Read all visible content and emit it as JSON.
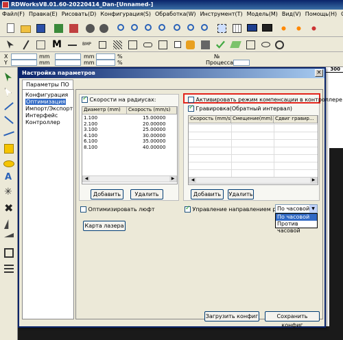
{
  "app": {
    "title": "RDWorksV8.01.60-20220414_Dan-[Unnamed-]"
  },
  "menu": [
    "Файл(F)",
    "Правка(E)",
    "Рисовать(D)",
    "Конфигурация(S)",
    "Обработка(W)",
    "Инструмент(T)",
    "Модель(M)",
    "Вид(V)",
    "Помощь(H)",
    "Связь со всеми"
  ],
  "coords": {
    "x_label": "X",
    "y_label": "Y",
    "x_value": "0",
    "y_value": "0",
    "unit1": "mm",
    "unit2": "mm",
    "pct": "%",
    "num_label": "№",
    "process_label": "Процесса:",
    "process_value": "0"
  },
  "ruler": {
    "tick": "300"
  },
  "dialog": {
    "title": "Настройка параметров",
    "close": "×",
    "tab": "Параметры ПО",
    "nav": [
      "Конфигурация",
      "Оптимизация",
      "Импорт/Экспорт",
      "Интерфейс",
      "Контроллер"
    ],
    "nav_selected": 1,
    "speeds_check": "Скорости на радиусах:",
    "speeds_cols": [
      "Диаметр (mm)",
      "Скорость (mm/s)"
    ],
    "speeds_rows": [
      [
        "1.100",
        "15.00000"
      ],
      [
        "2.100",
        "20.00000"
      ],
      [
        "3.100",
        "25.00000"
      ],
      [
        "4.100",
        "30.00000"
      ],
      [
        "6.100",
        "35.00000"
      ],
      [
        "8.100",
        "40.00000"
      ]
    ],
    "add": "Добавить",
    "delete": "Удалить",
    "compensation_check": "Активировать режим компенсации в контроллере",
    "engraving_check": "Гравировка(Обратный интервал)",
    "comp_cols": [
      "Скорость (mm/s)",
      "Смещение(mm)...",
      "Сдвиг гравир..."
    ],
    "add2": "Добавить",
    "delete2": "Удалить",
    "optimize_backlash": "Оптимизировать люфт",
    "cut_direction": "Управление направлением резки",
    "direction_value": "По часовой",
    "direction_options": [
      "По часовой",
      "Против часовой"
    ],
    "direction_highlight": 0,
    "laser_card": "Карта лазера",
    "load_config": "Загрузить конфиг",
    "save_config": "Сохранить конфиг"
  },
  "colors": {
    "highlight_box": "#e2231a",
    "selection": "#316ac5"
  }
}
